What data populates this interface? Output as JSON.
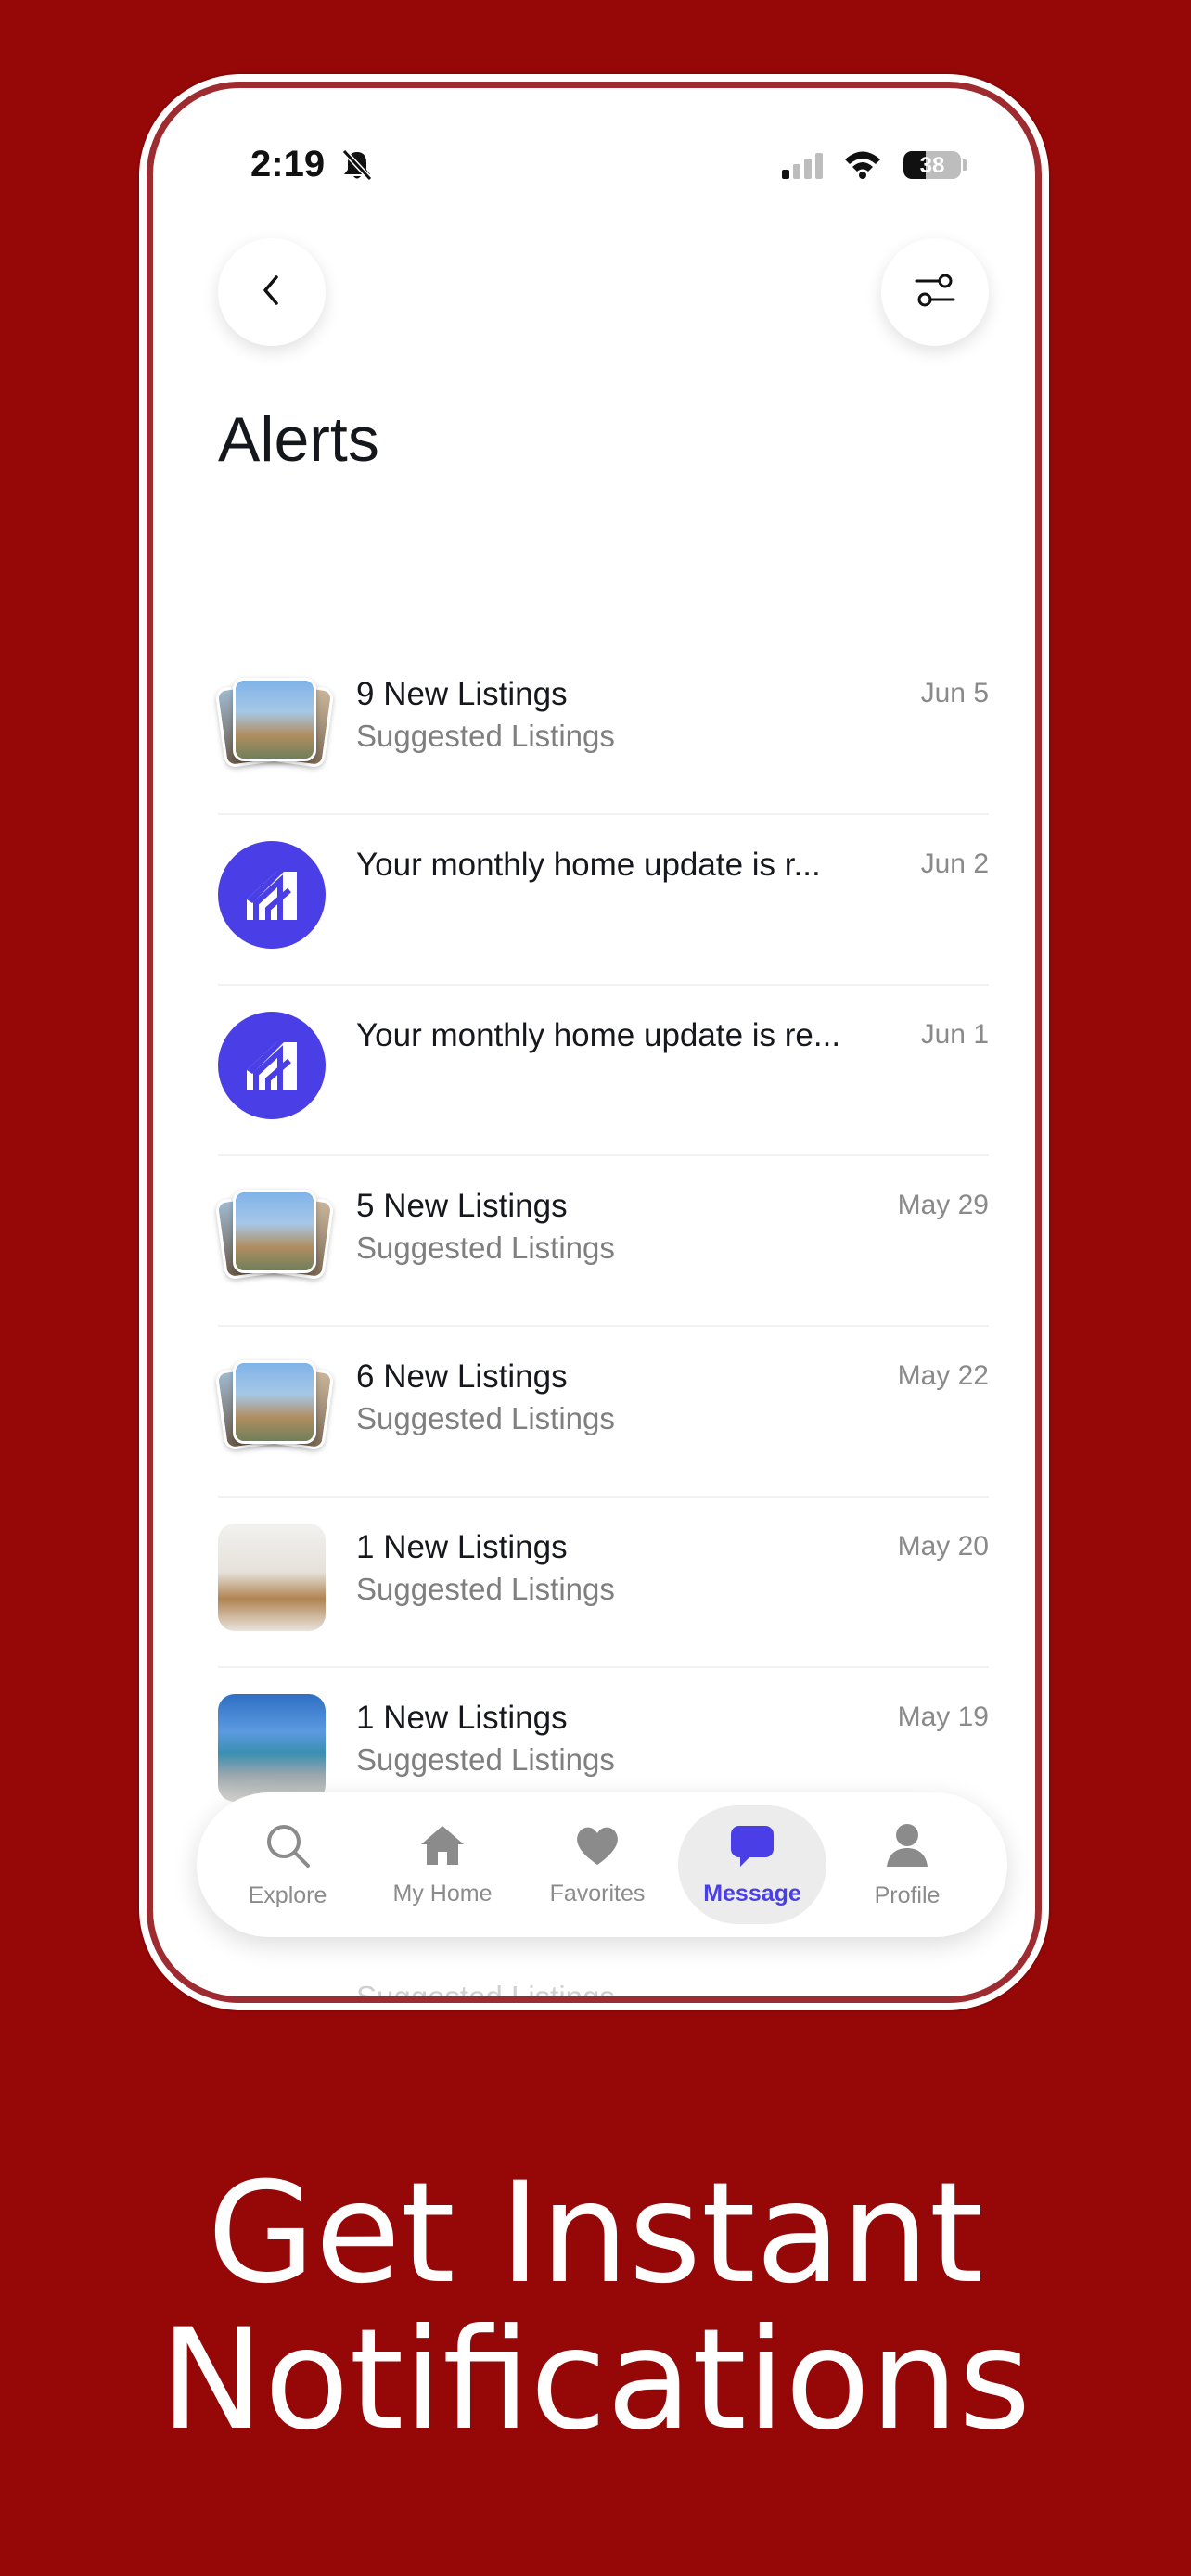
{
  "status_bar": {
    "time": "2:19",
    "battery_percent": "38",
    "battery_level": 0.38
  },
  "header": {
    "title": "Alerts"
  },
  "alerts": [
    {
      "title": "9 New Listings",
      "subtitle": "Suggested Listings",
      "date": "Jun 5",
      "thumb": "stack"
    },
    {
      "title": "Your monthly home update is r...",
      "subtitle": "",
      "date": "Jun 2",
      "thumb": "brand"
    },
    {
      "title": "Your monthly home update is re...",
      "subtitle": "",
      "date": "Jun 1",
      "thumb": "brand"
    },
    {
      "title": "5 New Listings",
      "subtitle": "Suggested Listings",
      "date": "May 29",
      "thumb": "stack"
    },
    {
      "title": "6 New Listings",
      "subtitle": "Suggested Listings",
      "date": "May 22",
      "thumb": "stack"
    },
    {
      "title": "1 New Listings",
      "subtitle": "Suggested Listings",
      "date": "May 20",
      "thumb": "interior"
    },
    {
      "title": "1 New Listings",
      "subtitle": "Suggested Listings",
      "date": "May 19",
      "thumb": "street"
    }
  ],
  "peek_text": "Suggested Listings",
  "tabbar": {
    "tabs": [
      {
        "label": "Explore",
        "icon": "search-icon"
      },
      {
        "label": "My Home",
        "icon": "home-icon"
      },
      {
        "label": "Favorites",
        "icon": "heart-icon"
      },
      {
        "label": "Message",
        "icon": "chat-icon",
        "active": true
      },
      {
        "label": "Profile",
        "icon": "user-icon"
      }
    ]
  },
  "promo": {
    "line1": "Get Instant",
    "line2": "Notifications"
  },
  "colors": {
    "background": "#960707",
    "accent": "#4a3fe6",
    "frame": "#9d2b2f"
  }
}
